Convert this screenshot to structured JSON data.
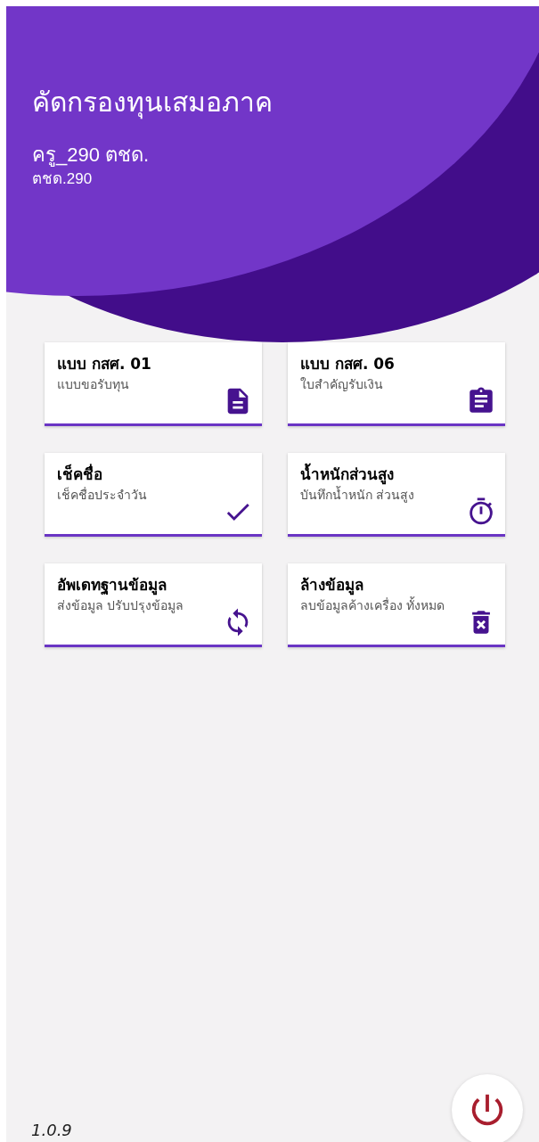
{
  "header": {
    "title": "คัดกรองทุนเสมอภาค",
    "user_name": "ครู_290 ตชด.",
    "user_code": "ตชด.290"
  },
  "menu_cards": [
    {
      "title": "แบบ กสศ. 01",
      "subtitle": "แบบขอรับทุน",
      "kind": "form"
    },
    {
      "title": "แบบ กสศ. 06",
      "subtitle": "ใบสำคัญรับเงิน",
      "kind": "clipboard"
    },
    {
      "title": "เช็คชื่อ",
      "subtitle": "เช็คชื่อประจำวัน",
      "kind": "check"
    },
    {
      "title": "น้ำหนักส่วนสูง",
      "subtitle": "บันทึกน้ำหนัก ส่วนสูง",
      "kind": "timer"
    },
    {
      "title": "อัพเดทฐานข้อมูล",
      "subtitle": "ส่งข้อมูล ปรับปรุงข้อมูล",
      "kind": "sync"
    },
    {
      "title": "ล้างข้อมูล",
      "subtitle": "ลบข้อมูลค้างเครื่อง ทั้งหมด",
      "kind": "delete"
    }
  ],
  "version": "1.0.9"
}
